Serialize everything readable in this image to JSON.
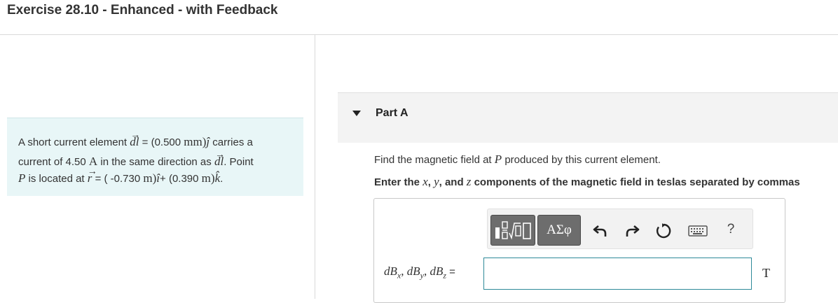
{
  "header": {
    "title": "Exercise 28.10 - Enhanced - with Feedback"
  },
  "problem": {
    "line1_pre": "A short current element ",
    "dl_symbol": "dl",
    "line1_eq": " = (0.500 ",
    "unit_mm": "mm",
    "close_paren": ")",
    "j_hat": "ĵ",
    "line1_post": " carries a",
    "line2_pre": "current of 4.50 ",
    "unit_A": "A",
    "line2_mid": " in the same direction as ",
    "line2_post": ". Point",
    "P": "P",
    "line3_mid": " is located at ",
    "r_symbol": "r",
    "line3_eq1": " = ( -0.730 ",
    "unit_m": "m",
    "i_hat": "î",
    "line3_eq2": "+ (0.390 ",
    "k_hat": "k̂",
    "period": "."
  },
  "part": {
    "title": "Part A"
  },
  "question": {
    "pre": "Find the magnetic field at ",
    "P": "P",
    "post": " produced by this current element."
  },
  "instruction": {
    "pre": "Enter the ",
    "x": "x",
    "sep1": ", ",
    "y": "y",
    "sep2": ", and ",
    "z": "z",
    "post": " components of the magnetic field in teslas separated by commas"
  },
  "toolbar": {
    "templates_icon": "templates-icon",
    "greek_label": "ΑΣφ",
    "help_label": "?"
  },
  "answer": {
    "variable_label": "dB_x, dB_y, dB_z =",
    "d": "d",
    "B": "B",
    "sub_x": "x",
    "sub_y": "y",
    "sub_z": "z",
    "comma": ", ",
    "equals": " =",
    "value": "",
    "unit": "T"
  }
}
